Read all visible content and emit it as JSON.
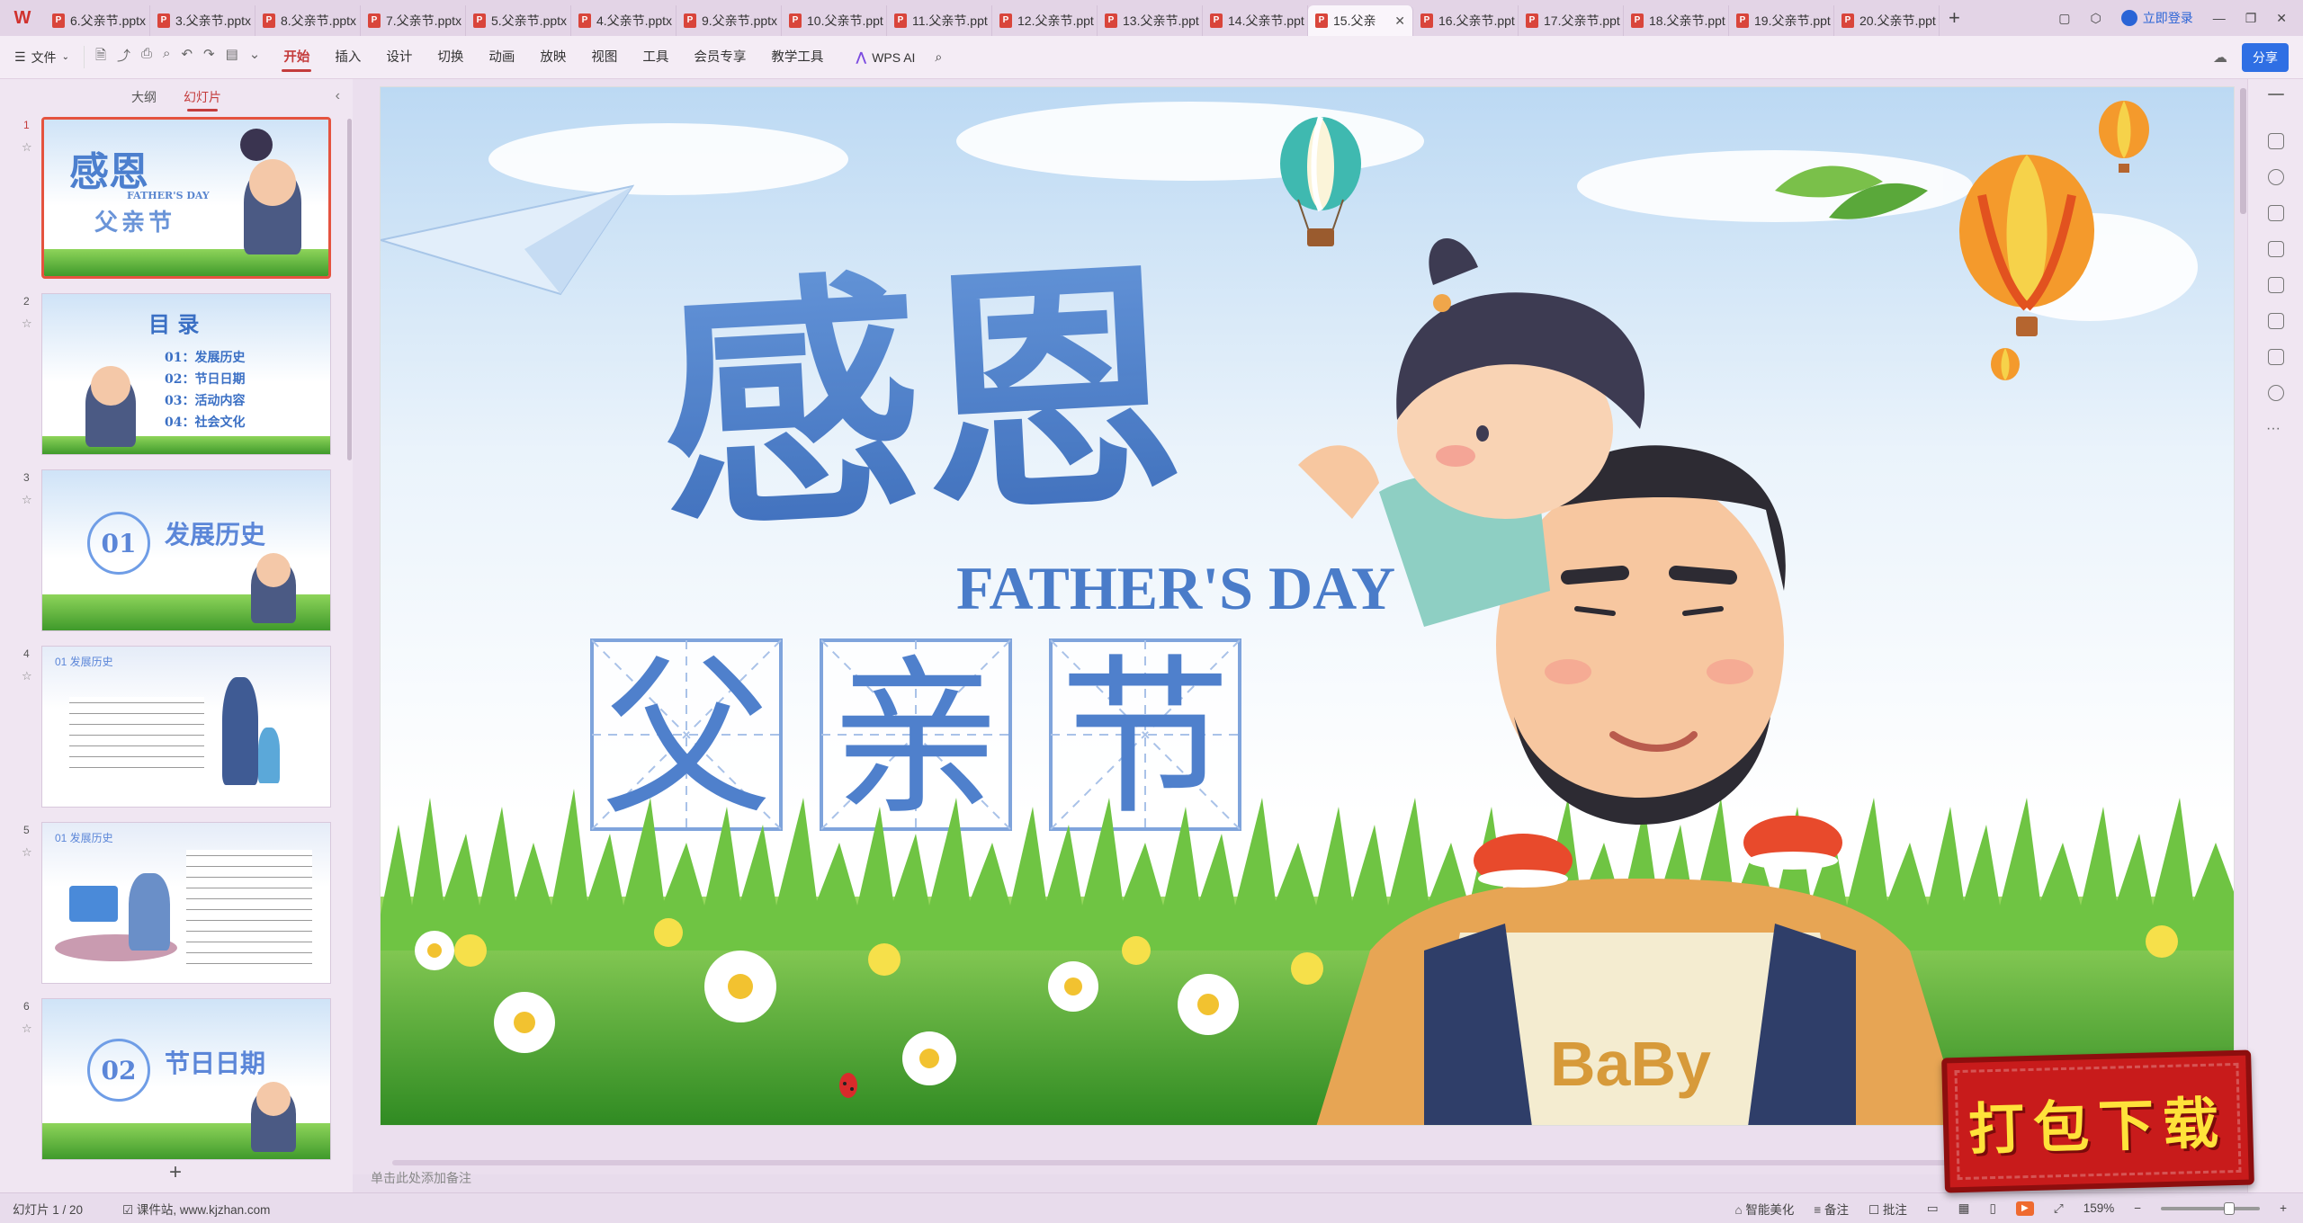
{
  "app": {
    "logo": "W"
  },
  "tabs": [
    {
      "label": "6.父亲节.pptx"
    },
    {
      "label": "3.父亲节.pptx"
    },
    {
      "label": "8.父亲节.pptx"
    },
    {
      "label": "7.父亲节.pptx"
    },
    {
      "label": "5.父亲节.pptx"
    },
    {
      "label": "4.父亲节.pptx"
    },
    {
      "label": "9.父亲节.pptx"
    },
    {
      "label": "10.父亲节.ppt"
    },
    {
      "label": "11.父亲节.ppt"
    },
    {
      "label": "12.父亲节.ppt"
    },
    {
      "label": "13.父亲节.ppt"
    },
    {
      "label": "14.父亲节.ppt"
    },
    {
      "label": "15.父亲"
    },
    {
      "label": "16.父亲节.ppt"
    },
    {
      "label": "17.父亲节.ppt"
    },
    {
      "label": "18.父亲节.ppt"
    },
    {
      "label": "19.父亲节.ppt"
    },
    {
      "label": "20.父亲节.ppt"
    }
  ],
  "titlebar": {
    "login": "立即登录"
  },
  "menubar": {
    "file": "文件",
    "items": [
      "开始",
      "插入",
      "设计",
      "切换",
      "动画",
      "放映",
      "视图",
      "工具",
      "会员专享",
      "教学工具"
    ],
    "active": "开始",
    "wps_ai": "WPS AI",
    "share": "分享"
  },
  "panel": {
    "tab_outline": "大纲",
    "tab_slides": "幻灯片"
  },
  "thumbnails": [
    {
      "num": "1",
      "title": "感恩",
      "sub": "FATHER'S DAY",
      "sub2": "父亲节"
    },
    {
      "num": "2",
      "title": "目 录",
      "lines": [
        "01：发展历史",
        "02：节日日期",
        "03：活动内容",
        "04：社会文化"
      ]
    },
    {
      "num": "3",
      "circle": "01",
      "title": "发展历史"
    },
    {
      "num": "4",
      "head": "01 发展历史"
    },
    {
      "num": "5",
      "head": "01 发展历史"
    },
    {
      "num": "6",
      "circle": "02",
      "title": "节日日期"
    }
  ],
  "slide": {
    "title": "感恩",
    "subtitle": "FATHER'S DAY",
    "chars": [
      "父",
      "亲",
      "节"
    ]
  },
  "notes": {
    "placeholder": "单击此处添加备注"
  },
  "status": {
    "slide_count": "幻灯片 1 / 20",
    "site": "课件站, www.kjzhan.com",
    "smart": "智能美化",
    "notes": "备注",
    "comments": "批注",
    "zoom": "159%"
  },
  "stamp": {
    "text": "打包下载"
  },
  "colors": {
    "accent": "#c43c3c",
    "title_blue": "#3f74c8",
    "grass": "#4ca832"
  }
}
